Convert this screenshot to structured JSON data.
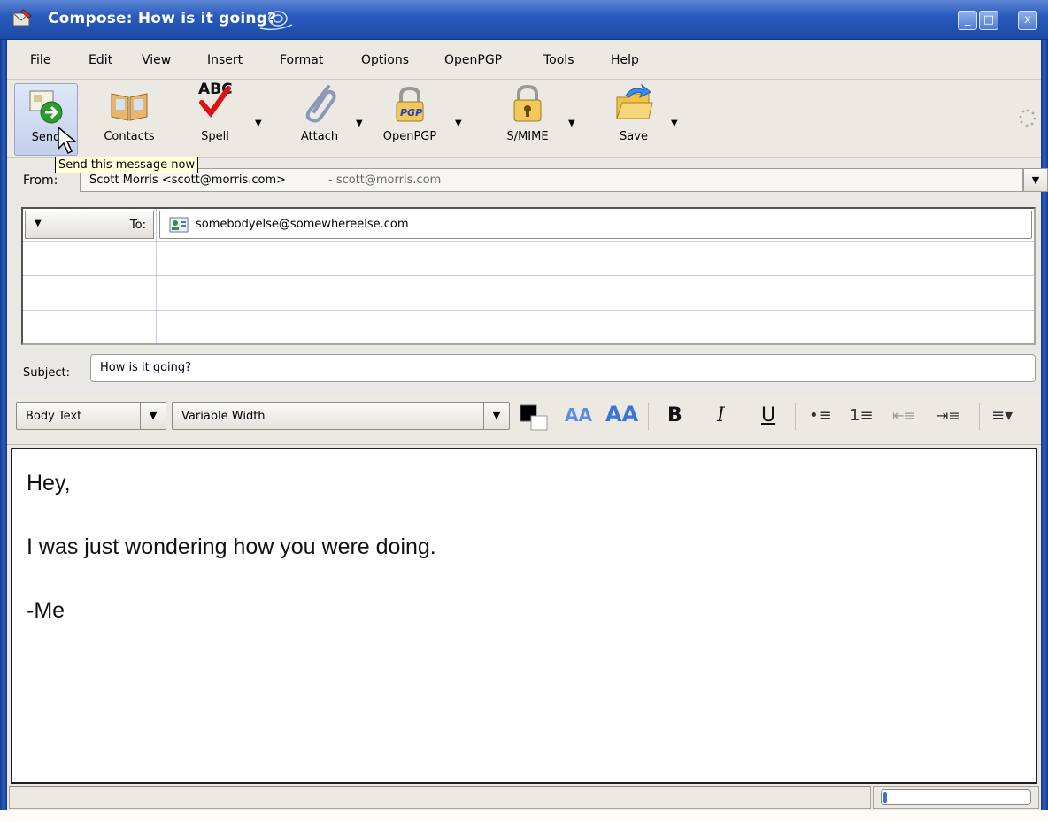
{
  "window": {
    "title": "Compose: How is it going?",
    "minimize_glyph": "_",
    "maximize_glyph": "□",
    "close_glyph": "x"
  },
  "menu": [
    "File",
    "Edit",
    "View",
    "Insert",
    "Format",
    "Options",
    "OpenPGP",
    "Tools",
    "Help"
  ],
  "toolbar": {
    "send": "Send",
    "contacts": "Contacts",
    "spell": "Spell",
    "spell_icon_text": "ABC",
    "attach": "Attach",
    "openpgp": "OpenPGP",
    "smime": "S/MIME",
    "save": "Save",
    "dropdown_glyph": "▼",
    "tooltip": "Send this message now"
  },
  "from": {
    "label": "From:",
    "value": "Scott Morris <scott@morris.com>",
    "account": "- scott@morris.com"
  },
  "recipients": [
    {
      "type": "To:",
      "address": "somebodyelse@somewhereelse.com"
    }
  ],
  "subject": {
    "label": "Subject:",
    "value": "How is it going?"
  },
  "format": {
    "paragraph_style": "Body Text",
    "font": "Variable Width",
    "arrow": "▼",
    "bold": "B",
    "italic": "I",
    "underline": "U",
    "bullet_list": "•≡",
    "numbered_list": "1≡",
    "outdent": "⇤≡",
    "indent": "⇥≡",
    "align": "≡▾",
    "font_smaller": "AA",
    "font_larger": "AA"
  },
  "body": {
    "line1": "Hey,",
    "line2": "I was just wondering how you were doing.",
    "line3": "-Me"
  },
  "colors": {
    "titlebar": "#2a5bbe",
    "tooltip_bg": "#ffffdc"
  }
}
